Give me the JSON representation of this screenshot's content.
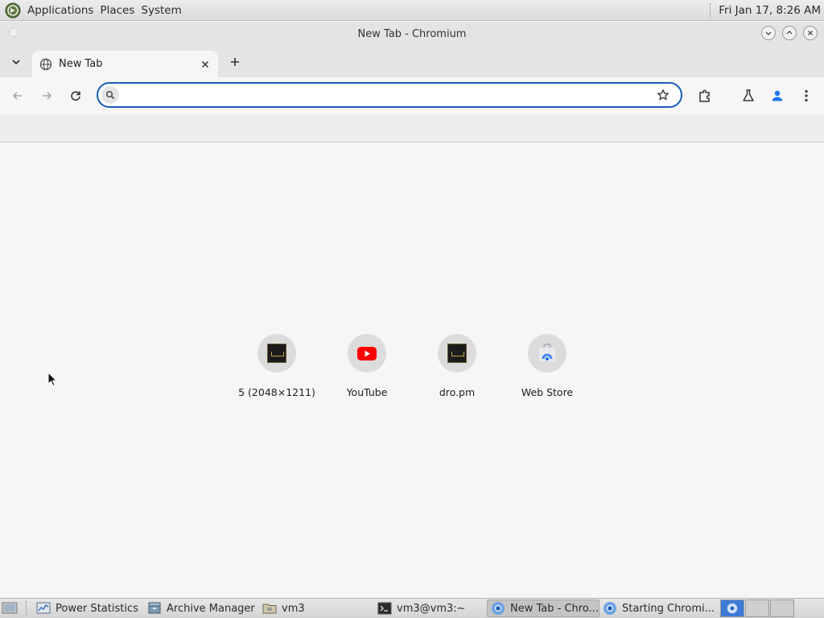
{
  "top_panel": {
    "menus": [
      "Applications",
      "Places",
      "System"
    ],
    "clock": "Fri Jan 17,  8:26 AM"
  },
  "window": {
    "title": "New Tab - Chromium"
  },
  "tabs": [
    {
      "title": "New Tab"
    }
  ],
  "omnibox": {
    "value": "",
    "placeholder": ""
  },
  "shortcuts": [
    {
      "label": "5 (2048×1211)",
      "icon": "image-thumbnail-icon"
    },
    {
      "label": "YouTube",
      "icon": "youtube-icon"
    },
    {
      "label": "dro.pm",
      "icon": "image-thumbnail-icon"
    },
    {
      "label": "Web Store",
      "icon": "web-store-icon"
    }
  ],
  "taskbar": {
    "items": [
      {
        "label": "Power Statistics",
        "icon": "power-statistics-icon"
      },
      {
        "label": "Archive Manager",
        "icon": "archive-manager-icon"
      },
      {
        "label": "vm3",
        "icon": "folder-icon"
      },
      {
        "label": "vm3@vm3:~",
        "icon": "terminal-icon"
      },
      {
        "label": "New Tab - Chro...",
        "icon": "chromium-icon",
        "active": true
      },
      {
        "label": "Starting Chromi...",
        "icon": "chromium-icon"
      }
    ]
  },
  "colors": {
    "accent": "#1a5fb4",
    "youtube_red": "#ff0000",
    "profile_blue": "#1a73e8"
  }
}
